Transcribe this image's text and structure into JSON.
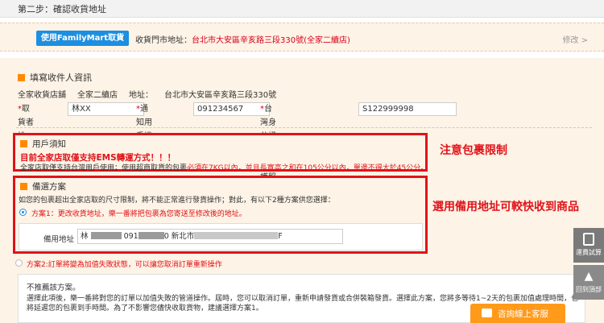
{
  "step": {
    "title": "第二步：確認收貨地址"
  },
  "store": {
    "button": "使用FamilyMart取貨",
    "addr_label": "收貨門市地址：",
    "addr_value": "台北市大安區辛亥路三段330號(全家二續店)",
    "modify": "修改 >"
  },
  "recipient": {
    "title": "填寫收件人資訊",
    "info": [
      "全家收貨店舖",
      "全家二續店",
      "地址：",
      "台北市大安區辛亥路三段330號"
    ],
    "name_label": "取貨者姓名：",
    "name_value": "林XX",
    "phone_label": "通知用手機號：",
    "phone_value": "091234567",
    "id_label": "台灣身分證號碼/護照號碼：",
    "id_value": "S122999998",
    "star": "*"
  },
  "notice": {
    "title": "用戶須知",
    "red_line": "目前全家店取僅支持EMS轉運方式！！！",
    "text_a": "全家店取僅支持台灣用戶使用；使用超商取貨的包裹",
    "text_b": "必須在7KG以內，並且長寬高之和在105公分以內，單邊不得大於45公分。"
  },
  "alt": {
    "title": "備選方案",
    "desc": "如您的包裹超出全家店取的尺寸限制，將不能正常進行發貨操作；對此，有以下2種方案供您選擇：",
    "opt1": "方案1：更改收貨地址，樂一番將把包裹為您寄送至修改後的地址。",
    "addr_label": "備用地址",
    "addr_p1": "林",
    "addr_p2": "091",
    "addr_p3": "0 新北市",
    "addr_p4": "F",
    "opt2": "方案2:訂單將變為加值失敗狀態，可以讓您取消訂單重新操作"
  },
  "annotations": {
    "a1": "注意包裹限制",
    "a2": "選用備用地址可較快收到商品"
  },
  "warning": {
    "title": "不推薦該方案。",
    "l1": "選擇此項後，樂一番將對您的訂單以加值失敗的管道操作。屆時，您可以取消訂單，重新申請發貨或合併裝箱發貨。選擇此方案，您將多等待1~2天的包裹加值處理時間，也",
    "l2": "將延遲您的包裹到手時間。為了不影響您儘快收取貨物，建議選擇方案1。"
  },
  "side": {
    "calc": "運費試算",
    "top": "回到頂部"
  },
  "chat": {
    "label": "咨詢線上客服"
  },
  "colors": {
    "accent_blue": "#1c8fe0",
    "red": "#e0131a",
    "orange": "#ff8a00",
    "panel": "#fdf3e6"
  }
}
